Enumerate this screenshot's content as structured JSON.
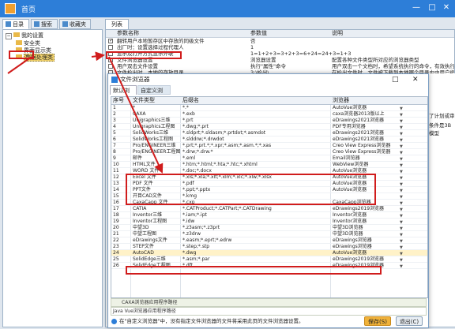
{
  "window": {
    "title": "首页"
  },
  "left_tabs": [
    {
      "label": "目录"
    },
    {
      "label": "搜索"
    },
    {
      "label": "收藏夹"
    }
  ],
  "tree": {
    "root": "我的设置",
    "items": [
      "安全类",
      "界面显示类",
      "数据处理类"
    ],
    "selected": "数据处理类"
  },
  "right_tab": "列表",
  "params": {
    "headers": {
      "name": "参数名称",
      "value": "参数值",
      "desc": "说明"
    },
    "rows": [
      {
        "checked": true,
        "name": "翻转用户本地暂存区中存放的同级文件",
        "value": "否",
        "desc": ""
      },
      {
        "checked": false,
        "name": "出厂时：设置选择过程代理人",
        "value": "1",
        "desc": ""
      },
      {
        "checked": false,
        "name": "显示及打开方式显示外联",
        "value": "1=1+2+3=3+2+3=6+24=24+3=1+3",
        "desc": ""
      },
      {
        "checked": true,
        "name": "文件浏览器设置",
        "value": "浏览器设置",
        "desc": "配置各种文件类型所对应的浏览器类型"
      },
      {
        "checked": false,
        "name": "用户双击文件设置",
        "value": "执行\"属性\"命令",
        "desc": "用户双击一个文档时，希望系统执行的命令，有效执行"
      },
      {
        "checked": false,
        "name": "文件检出时，本地的存放目录",
        "value": "3:\\检出\\",
        "desc": "在检出文件时，文件被下载到本地哪个目录中由用户缩放"
      }
    ]
  },
  "dialog": {
    "title": "文件浏览器",
    "tabs": [
      "默认浏览器",
      "自定义浏览器"
    ],
    "headers": {
      "seq": "序号",
      "type": "文件类型",
      "ext": "后缀名",
      "browser": "浏览器"
    },
    "rows": [
      {
        "seq": "1",
        "type": "*",
        "ext": "*.*",
        "browser": "AutoVue浏览器"
      },
      {
        "seq": "2",
        "type": "CAXA",
        "ext": "*.exb",
        "browser": "caxa浏览器2013版以上"
      },
      {
        "seq": "3",
        "type": "Unigraphics三维",
        "ext": "*.prt",
        "browser": "eDrawings2021浏览器"
      },
      {
        "seq": "4",
        "type": "Unigraphics工程图",
        "ext": "*.dwg;*.prt",
        "browser": "PDF专用浏览器"
      },
      {
        "seq": "5",
        "type": "SolidWorks三维",
        "ext": "*.sldprt;*.sldasm;*.prtdot;*.asmdot",
        "browser": "eDrawings2021浏览器"
      },
      {
        "seq": "6",
        "type": "SolidWorks工程图",
        "ext": "*.slddrw;*.drwdot",
        "browser": "eDrawings2021浏览器"
      },
      {
        "seq": "7",
        "type": "Pro/ENGINEER三维",
        "ext": "*.prt;*.prt.*;*.xpr;*.asm;*.asm.*;*.xas",
        "browser": "Creo View Express浏览器"
      },
      {
        "seq": "8",
        "type": "Pro/ENGINEER工程图",
        "ext": "*.drw;*.drw.*",
        "browser": "Creo View Express浏览器"
      },
      {
        "seq": "9",
        "type": "邮件",
        "ext": "*.eml",
        "browser": "Email浏览器"
      },
      {
        "seq": "10",
        "type": "HTML文件",
        "ext": "*.htm;*.html;*.hta;*.htc;*.xhtml",
        "browser": "WebView浏览器"
      },
      {
        "seq": "11",
        "type": "WORD 文件",
        "ext": "*.doc;*.docx",
        "browser": "AutoVue浏览器"
      },
      {
        "seq": "12",
        "type": "Excel 文件",
        "ext": "*.xls;*.xla;*.xlt;*.xlm;*.xlc;*.xlw;*.xlsx",
        "browser": "AutoVue浏览器"
      },
      {
        "seq": "13",
        "type": "PDF 文件",
        "ext": "*.pdf",
        "browser": "AutoVue浏览器"
      },
      {
        "seq": "14",
        "type": "PPT文件",
        "ext": "*.ppt;*.pptx",
        "browser": "AutoVue浏览器"
      },
      {
        "seq": "15",
        "type": "开目CAD文件",
        "ext": "*.kmg",
        "browser": ""
      },
      {
        "seq": "16",
        "type": "CaxaCapp 文件",
        "ext": "*.cxp",
        "browser": "CaxaCapp浏览器"
      },
      {
        "seq": "17",
        "type": "CATIA",
        "ext": "*.CATProduct;*.CATPart;*.CATDrawing",
        "browser": "eDrawings2019浏览器"
      },
      {
        "seq": "18",
        "type": "Inventor三维",
        "ext": "*.iam;*.ipt",
        "browser": "Inventor浏览器"
      },
      {
        "seq": "19",
        "type": "Inventor工程图",
        "ext": "*.idw",
        "browser": "Inventor浏览器"
      },
      {
        "seq": "20",
        "type": "中望3D",
        "ext": "*.z3asm;*.z3prt",
        "browser": "中望3D浏览器"
      },
      {
        "seq": "21",
        "type": "中望工程图",
        "ext": "*.z3drw",
        "browser": "中望3D浏览器"
      },
      {
        "seq": "22",
        "type": "eDrawings文件",
        "ext": "*.easm;*.eprt;*.edrw",
        "browser": "eDrawings浏览器"
      },
      {
        "seq": "23",
        "type": "STEP文件",
        "ext": "*.step;*.stp",
        "browser": "eDrawings浏览器"
      },
      {
        "seq": "24",
        "type": "AutoCAD",
        "ext": "*.dwg",
        "browser": "AutoVue浏览器"
      },
      {
        "seq": "25",
        "type": "SolidEdge三维",
        "ext": "*.asm;*.par",
        "browser": "eDrawings2019浏览器"
      },
      {
        "seq": "26",
        "type": "SolidEdge工程图",
        "ext": "*.dft",
        "browser": "eDrawings2019浏览器"
      }
    ],
    "hint_rows": [
      "CAXA浏览器应用程序路径",
      "Java Vue浏览器应用程序路径"
    ],
    "footer_text": "在\"自定义浏览器\"中，没有指定文件浏览器的文件将采用此页的文件浏览器设置。",
    "save_label": "保存(S)",
    "exit_label": "退出(C)"
  },
  "side_clip": {
    "line1": "了计划或审",
    "line2": "条件是3B模型"
  },
  "colors": {
    "titlebar": "#2d7ed8",
    "annotation": "#d01c1c",
    "highlight": "#fff2c8"
  }
}
